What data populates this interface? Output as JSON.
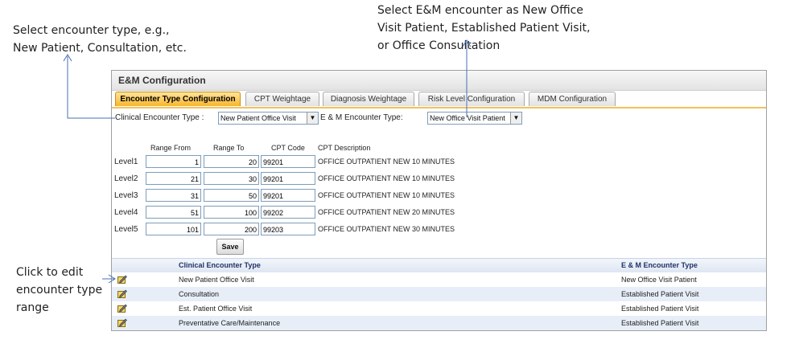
{
  "callouts": {
    "top_left": [
      "Select encounter type, e.g.,",
      "New Patient, Consultation, etc."
    ],
    "top_right": [
      "Select E&M encounter as New Office",
      "Visit Patient, Established Patient Visit,",
      "or Office Consultation"
    ],
    "left": [
      "Click to edit",
      "encounter type",
      "range"
    ]
  },
  "panel": {
    "title": "E&M Configuration"
  },
  "tabs": [
    {
      "label": "Encounter Type Configuration",
      "active": true
    },
    {
      "label": "CPT Weightage",
      "active": false
    },
    {
      "label": "Diagnosis Weightage",
      "active": false
    },
    {
      "label": "Risk Level Configuration",
      "active": false
    },
    {
      "label": "MDM Configuration",
      "active": false
    }
  ],
  "filters": {
    "clinical_label": "Clinical Encounter Type :",
    "clinical_value": "New Patient Office Visit",
    "em_label": "E & M Encounter Type:",
    "em_value": "New Office Visit Patient"
  },
  "grid": {
    "headers": [
      "Range From",
      "Range To",
      "CPT Code",
      "CPT Description"
    ],
    "rows": [
      {
        "level": "Level1",
        "from": "1",
        "to": "20",
        "code": "99201",
        "desc": "OFFICE OUTPATIENT NEW 10 MINUTES"
      },
      {
        "level": "Level2",
        "from": "21",
        "to": "30",
        "code": "99201",
        "desc": "OFFICE OUTPATIENT NEW 10 MINUTES"
      },
      {
        "level": "Level3",
        "from": "31",
        "to": "50",
        "code": "99201",
        "desc": "OFFICE OUTPATIENT NEW 10 MINUTES"
      },
      {
        "level": "Level4",
        "from": "51",
        "to": "100",
        "code": "99202",
        "desc": "OFFICE OUTPATIENT NEW 20 MINUTES"
      },
      {
        "level": "Level5",
        "from": "101",
        "to": "200",
        "code": "99203",
        "desc": "OFFICE OUTPATIENT NEW 30 MINUTES"
      }
    ],
    "save_label": "Save"
  },
  "list": {
    "headers": [
      "Clinical Encounter Type",
      "E & M Encounter Type"
    ],
    "rows": [
      {
        "type": "New Patient Office Visit",
        "em": "New Office Visit Patient"
      },
      {
        "type": "Consultation",
        "em": "Established Patient Visit"
      },
      {
        "type": "Est. Patient Office Visit",
        "em": "Established Patient Visit"
      },
      {
        "type": "Preventative Care/Maintenance",
        "em": "Established Patient Visit"
      }
    ],
    "edit_icon": "edit-icon"
  }
}
